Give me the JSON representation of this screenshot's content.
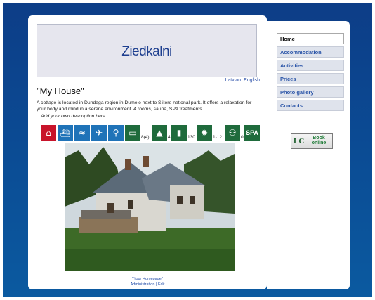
{
  "site": {
    "title": "Ziedkalni"
  },
  "languages": [
    "Latvian",
    "English"
  ],
  "page": {
    "heading": "\"My House\"",
    "description": "A cottage is located in Dundaga region in Dumele next to Slitere national park. It offers a relaxation for your body and mind in a serene environment. 4 rooms, sauna, SPA treatments.",
    "own_description": "Add your own description here ..."
  },
  "icons": [
    {
      "name": "house-icon",
      "glyph": "⌂"
    },
    {
      "name": "boat-icon",
      "glyph": "⛴"
    },
    {
      "name": "surf-icon",
      "glyph": "≈"
    },
    {
      "name": "bird-icon",
      "glyph": "✈"
    },
    {
      "name": "bicycle-icon",
      "glyph": "⚲"
    },
    {
      "name": "bed-icon",
      "glyph": "▭",
      "count": "8(4)"
    },
    {
      "name": "lake-icon",
      "glyph": "▲",
      "count": "4"
    },
    {
      "name": "distance-icon",
      "glyph": "▮",
      "count": "130"
    },
    {
      "name": "sun-icon",
      "glyph": "✹",
      "count": "1-12"
    },
    {
      "name": "people-icon",
      "glyph": "⚇",
      "count": "0"
    },
    {
      "name": "spa-icon",
      "glyph": "SPA"
    }
  ],
  "nav": {
    "items": [
      "Home",
      "Accommodation",
      "Activities",
      "Prices",
      "Photo gallery",
      "Contacts"
    ],
    "active": "Home"
  },
  "book": {
    "line1": "Book",
    "line2": "online",
    "logo": "LC"
  },
  "footer": {
    "homepage": "\"Your Homepage\"",
    "admin": "Administration",
    "edit": "Edit",
    "sep": "|"
  }
}
